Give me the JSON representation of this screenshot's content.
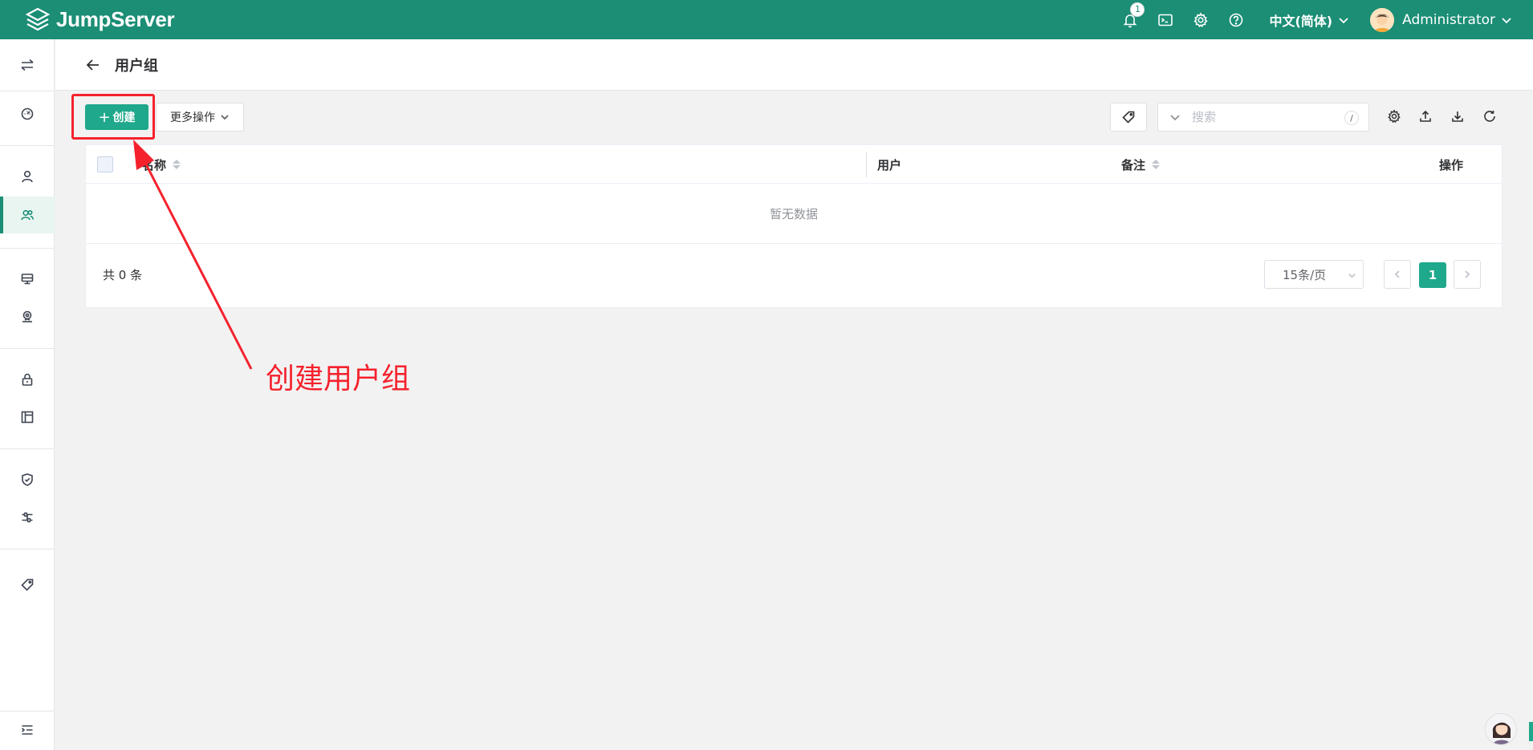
{
  "app": {
    "name": "JumpServer",
    "brand_color": "#1b8e75",
    "accent_color": "#1fa88b",
    "annotation_color": "#f5222d"
  },
  "topbar": {
    "notification_count": "1",
    "icons": [
      "bell-icon",
      "terminal-icon",
      "gear-icon",
      "help-icon"
    ],
    "language": "中文(简体)",
    "user_name": "Administrator"
  },
  "sidebar": {
    "items": [
      {
        "name": "switch-view-icon"
      },
      {
        "name": "dashboard-icon"
      },
      {
        "name": "user-icon"
      },
      {
        "name": "user-group-icon",
        "active": true
      },
      {
        "name": "asset-icon"
      },
      {
        "name": "location-icon"
      },
      {
        "name": "lock-icon"
      },
      {
        "name": "layout-icon"
      },
      {
        "name": "shield-check-icon"
      },
      {
        "name": "filter-settings-icon"
      },
      {
        "name": "tag-icon"
      },
      {
        "name": "collapse-menu-icon"
      }
    ]
  },
  "page": {
    "title": "用户组"
  },
  "toolbar": {
    "create_label": "创建",
    "more_label": "更多操作",
    "search_placeholder": "搜索",
    "search_shortcut": "/"
  },
  "table": {
    "columns": [
      "名称",
      "用户",
      "备注",
      "操作"
    ],
    "empty_text": "暂无数据"
  },
  "pagination": {
    "total_text": "共 0 条",
    "page_size": "15条/页",
    "current_page": "1"
  },
  "annotation": {
    "text": "创建用户组"
  }
}
